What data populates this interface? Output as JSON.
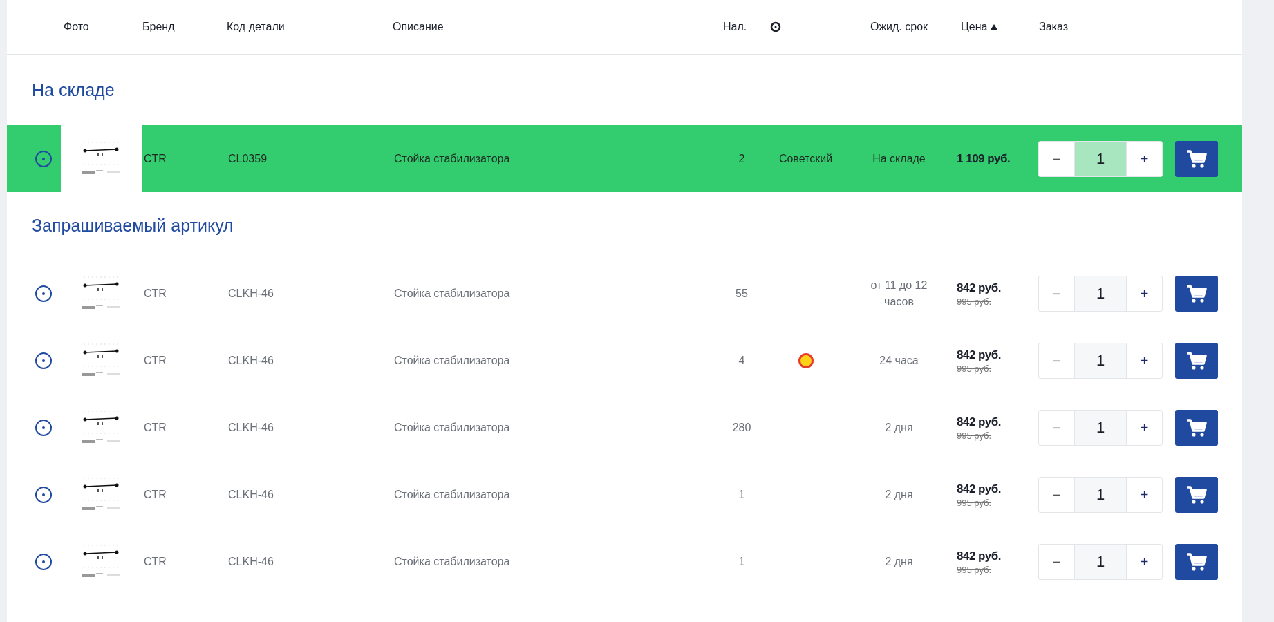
{
  "columns": [
    {
      "label": "Фото",
      "sortable": false
    },
    {
      "label": "Бренд",
      "sortable": false
    },
    {
      "label": "Код детали",
      "sortable": true,
      "sorted": false
    },
    {
      "label": "Описание",
      "sortable": true,
      "sorted": false
    },
    {
      "label": "Нал.",
      "sortable": true,
      "sorted": false
    },
    {
      "label": "Ожид. срок",
      "sortable": true,
      "sorted": false
    },
    {
      "label": "Цена",
      "sortable": true,
      "sorted": true
    },
    {
      "label": "Заказ",
      "sortable": false
    }
  ],
  "sections": [
    {
      "title": "На складе",
      "rows": [
        {
          "selected": true,
          "brand": "CTR",
          "code": "CL0359",
          "description": "Стойка стабилизатора",
          "stock": "2",
          "warehouse": "Советский",
          "marked": false,
          "delivery": "На складе",
          "price": "1 109 руб.",
          "quantity": "1",
          "decrement": "−",
          "increment": "+"
        }
      ]
    },
    {
      "title": "Запрашиваемый артикул",
      "rows": [
        {
          "selected": false,
          "brand": "CTR",
          "code": "CLKH-46",
          "description": "Стойка стабилизатора",
          "stock": "55",
          "marked": false,
          "delivery": "от 11 до 12 часов",
          "price": "842 руб.",
          "old_price": "995 руб.",
          "quantity": "1",
          "decrement": "−",
          "increment": "+"
        },
        {
          "selected": false,
          "brand": "CTR",
          "code": "CLKH-46",
          "description": "Стойка стабилизатора",
          "stock": "4",
          "marked": true,
          "delivery": "24 часа",
          "price": "842 руб.",
          "old_price": "995 руб.",
          "quantity": "1",
          "decrement": "−",
          "increment": "+"
        },
        {
          "selected": false,
          "brand": "CTR",
          "code": "CLKH-46",
          "description": "Стойка стабилизатора",
          "stock": "280",
          "marked": false,
          "delivery": "2 дня",
          "price": "842 руб.",
          "old_price": "995 руб.",
          "quantity": "1",
          "decrement": "−",
          "increment": "+"
        },
        {
          "selected": false,
          "brand": "CTR",
          "code": "CLKH-46",
          "description": "Стойка стабилизатора",
          "stock": "1",
          "marked": false,
          "delivery": "2 дня",
          "price": "842 руб.",
          "old_price": "995 руб.",
          "quantity": "1",
          "decrement": "−",
          "increment": "+"
        },
        {
          "selected": false,
          "brand": "CTR",
          "code": "CLKH-46",
          "description": "Стойка стабилизатора",
          "stock": "1",
          "marked": false,
          "delivery": "2 дня",
          "price": "842 руб.",
          "old_price": "995 руб.",
          "quantity": "1",
          "decrement": "−",
          "increment": "+"
        }
      ]
    }
  ]
}
